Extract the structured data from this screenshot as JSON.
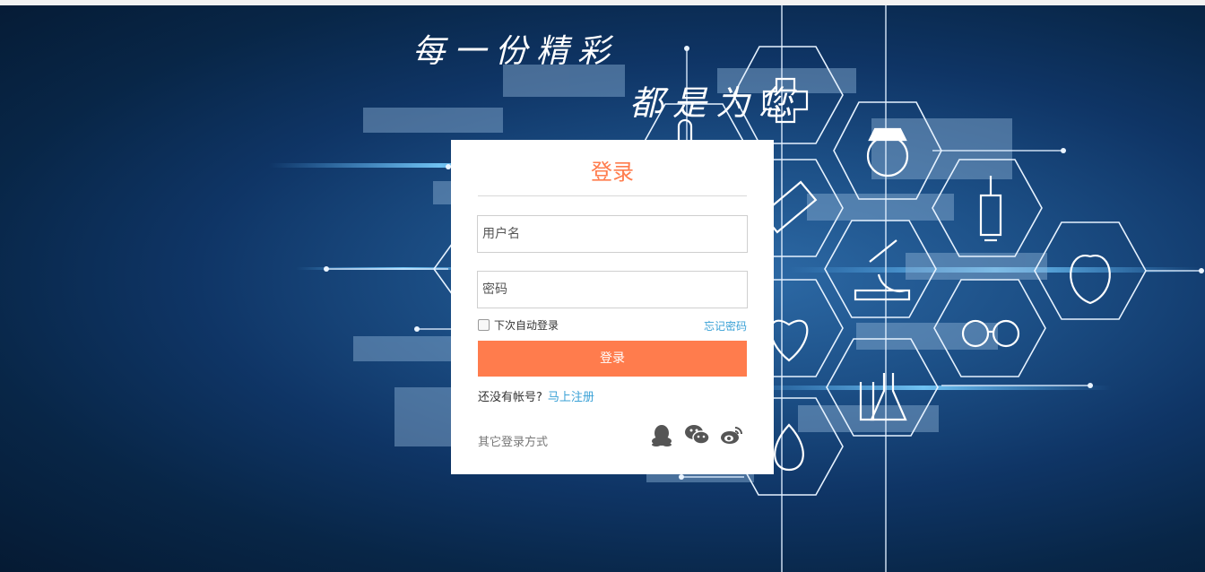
{
  "slogan": {
    "line1": "每一份精彩",
    "line2": "都是为您"
  },
  "login": {
    "title": "登录",
    "username_placeholder": "用户名",
    "password_placeholder": "密码",
    "remember_label": "下次自动登录",
    "forgot_label": "忘记密码",
    "submit_label": "登录",
    "no_account_text": "还没有帐号?",
    "register_link": "马上注册",
    "other_login_text": "其它登录方式"
  },
  "social_icons": [
    "qq-icon",
    "wechat-icon",
    "weibo-icon"
  ],
  "colors": {
    "accent": "#ff7c4d",
    "link": "#3aa1d6",
    "card": "#ffffff",
    "background": "#0f3566"
  }
}
